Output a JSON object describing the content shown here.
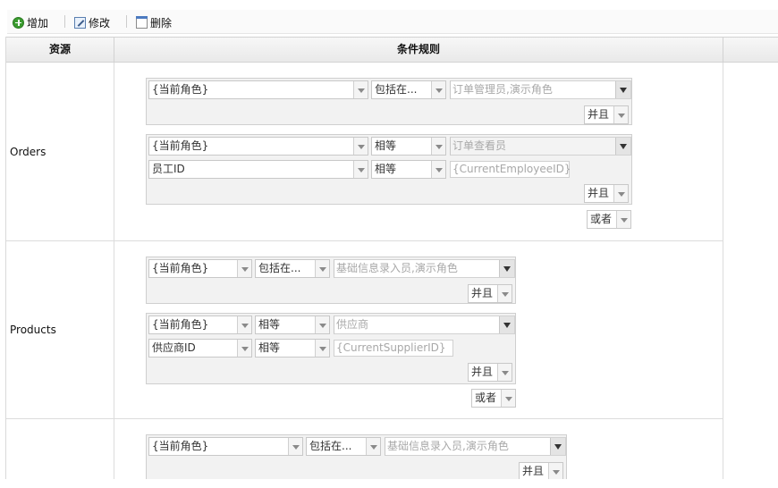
{
  "toolbar": {
    "add": "增加",
    "edit": "修改",
    "delete": "删除"
  },
  "columns": {
    "resource": "资源",
    "rule": "条件规则"
  },
  "rows": [
    {
      "resource": "Orders",
      "groups": [
        {
          "conditions": [
            {
              "field": "{当前角色}",
              "operator": "包括在...",
              "value": "订单管理员,演示角色"
            }
          ],
          "join": "并且"
        },
        {
          "conditions": [
            {
              "field": "{当前角色}",
              "operator": "相等",
              "value": "订单查看员"
            },
            {
              "field": "员工ID",
              "operator": "相等",
              "value": "{CurrentEmployeeID}"
            }
          ],
          "join": "并且"
        }
      ],
      "outer_join": "或者"
    },
    {
      "resource": "Products",
      "groups": [
        {
          "conditions": [
            {
              "field": "{当前角色}",
              "operator": "包括在...",
              "value": "基础信息录入员,演示角色"
            }
          ],
          "join": "并且"
        },
        {
          "conditions": [
            {
              "field": "{当前角色}",
              "operator": "相等",
              "value": "供应商"
            },
            {
              "field": "供应商ID",
              "operator": "相等",
              "value": "{CurrentSupplierID}"
            }
          ],
          "join": "并且"
        }
      ],
      "outer_join": "或者"
    },
    {
      "resource": "",
      "groups": [
        {
          "conditions": [
            {
              "field": "{当前角色}",
              "operator": "包括在...",
              "value": "基础信息录入员,演示角色"
            }
          ],
          "join": "并且"
        }
      ]
    }
  ]
}
